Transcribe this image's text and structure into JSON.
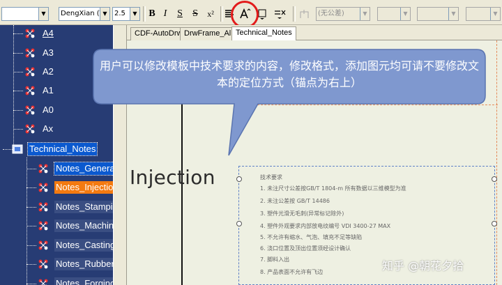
{
  "toolbar": {
    "font_name": "DengXian (Trе",
    "font_size": "2.5",
    "bold": "B",
    "italic": "I",
    "underline": "S",
    "strike": "S",
    "superscript": "x²",
    "tolerance_placeholder": "(无公差)"
  },
  "tree": {
    "items": [
      {
        "label": "A4"
      },
      {
        "label": "A3"
      },
      {
        "label": "A2"
      },
      {
        "label": "A1"
      },
      {
        "label": "A0"
      },
      {
        "label": "Ax"
      },
      {
        "label": "Technical_Notes"
      },
      {
        "label": "Notes_General"
      },
      {
        "label": "Notes_Injection"
      },
      {
        "label": "Notes_Stamping"
      },
      {
        "label": "Notes_Machining"
      },
      {
        "label": "Notes_Casting"
      },
      {
        "label": "Notes_Rubber"
      },
      {
        "label": "Notes_Forging"
      }
    ]
  },
  "tabs": [
    {
      "label": "CDF-AutoDrw"
    },
    {
      "label": "DrwFrame_All"
    },
    {
      "label": "Technical_Notes"
    }
  ],
  "drawing": {
    "title_word": "Injection",
    "notes": [
      "技术要求",
      "1. 未注尺寸公差按GB/T 1804-m 所有数据以三维模型为准",
      "2. 未注公差按 GB/T 14486",
      "3. 塑件光滑无毛刺(异常标记除外)",
      "4. 塑件外观要求内部放电纹编号 VDI 3400-27 MAX",
      "5. 不允许有缩水、气泡、填充不足等缺陷",
      "6. 浇口位置及顶出位置须经设计确认",
      "7. 脚料入出",
      "8. 产品表面不允许有飞边"
    ]
  },
  "callout": {
    "text": "用户可以修改模板中技术要求的内容，修改格式，添加图元均可请不要修改文本的定位方式（锚点为右上）"
  },
  "watermark": "知乎 @朝花夕拾",
  "colors": {
    "tree_bg": "#273c74",
    "selected_orange": "#f37a10",
    "callout_fill": "#7f98cf",
    "annotation_red": "#e21b1b"
  }
}
